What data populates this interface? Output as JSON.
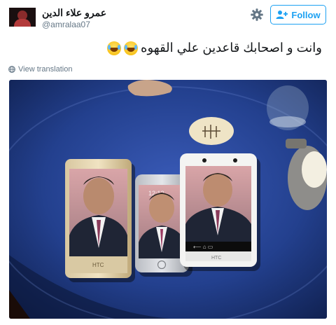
{
  "tweet": {
    "display_name": "عمرو علاء الدين",
    "handle": "@amralaa07",
    "text": "وانت و اصحابك قاعدين علي القهوه",
    "emojis": [
      "face-with-tears-of-joy-icon",
      "face-with-tears-of-joy-icon"
    ],
    "view_translation_label": "View translation"
  },
  "actions": {
    "follow_label": "Follow",
    "settings_icon": "gear-icon"
  },
  "photo": {
    "phone_brand_labels": [
      "HTC",
      "HTC"
    ]
  },
  "colors": {
    "accent": "#1da1f2",
    "secondary_text": "#657786",
    "photo_background": "#1b2f6b"
  }
}
